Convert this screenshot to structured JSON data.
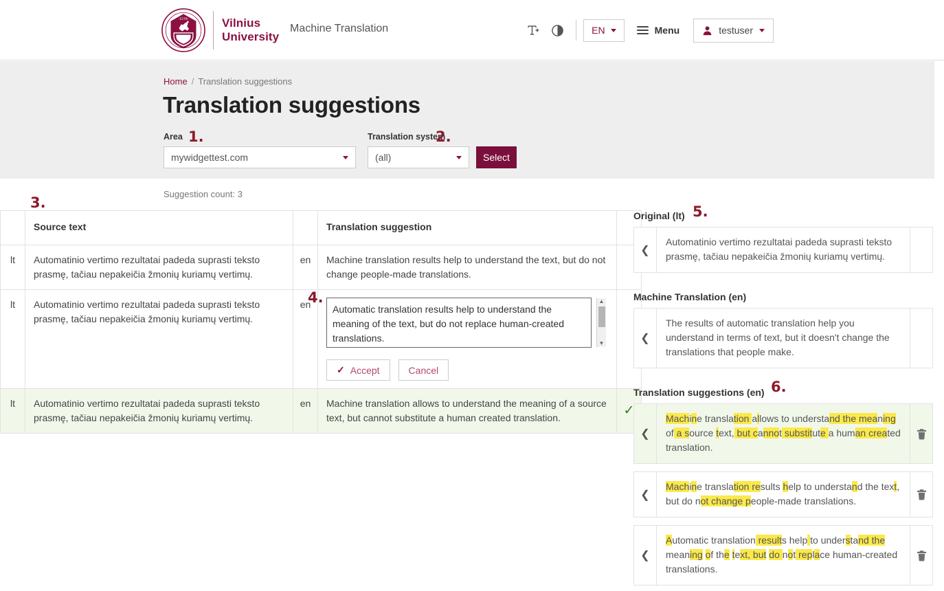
{
  "header": {
    "logo_line1": "Vilnius",
    "logo_line2": "University",
    "crest_year": "1579",
    "crest_top_text": "VILNIAUS UNIVERSITETAS",
    "crest_bottom_text": "UNIVERSITAS VILNENSIS",
    "app_title": "Machine Translation",
    "font_size_icon": "font-size-icon",
    "contrast_icon": "contrast-icon",
    "language": "EN",
    "menu_label": "Menu",
    "user_label": "testuser"
  },
  "breadcrumb": {
    "home": "Home",
    "separator": "/",
    "current": "Translation suggestions"
  },
  "page_title": "Translation suggestions",
  "filters": {
    "area_label": "Area",
    "area_value": "mywidgettest.com",
    "system_label": "Translation system",
    "system_value": "(all)",
    "select_button": "Select"
  },
  "annotations": {
    "a1": "1.",
    "a2": "2.",
    "a3": "3.",
    "a4": "4.",
    "a5": "5.",
    "a6": "6."
  },
  "suggestion_count": "Suggestion count: 3",
  "table": {
    "headers": {
      "lang": "",
      "source": "Source text",
      "target_lang": "",
      "suggestion": "Translation suggestion",
      "actions": ""
    },
    "rows": [
      {
        "src_lang": "lt",
        "source": "Automatinio vertimo rezultatai padeda suprasti teksto prasmę, tačiau nepakeičia žmonių kuriamų vertimų.",
        "tgt_lang": "en",
        "suggestion": "Machine translation results help to understand the text, but do not change people-made translations.",
        "action": ""
      },
      {
        "src_lang": "lt",
        "source": "Automatinio vertimo rezultatai padeda suprasti teksto prasmę, tačiau nepakeičia žmonių kuriamų vertimų.",
        "tgt_lang": "en",
        "editor_value": "Automatic translation results help to understand the meaning of the text, but do not replace human-created translations.",
        "accept_label": "Accept",
        "cancel_label": "Cancel",
        "action": ""
      },
      {
        "src_lang": "lt",
        "source": "Automatinio vertimo rezultatai padeda suprasti teksto prasmę, tačiau nepakeičia žmonių kuriamų vertimų.",
        "tgt_lang": "en",
        "suggestion": "Machine translation allows to understand the meaning of a source text, but cannot substitute a human created translation.",
        "action": "accepted-check"
      }
    ]
  },
  "panel": {
    "original_label": "Original (lt)",
    "original_text": "Automatinio vertimo rezultatai padeda suprasti teksto prasmę, tačiau nepakeičia žmonių kuriamų vertimų.",
    "machine_label": "Machine Translation (en)",
    "machine_text": "The results of automatic translation help you understand in terms of text, but it doesn't change the translations that people make.",
    "suggestions_label": "Translation suggestions (en)",
    "suggestions": [
      {
        "plain": "Machine translation allows to understand the meaning of a source text, but cannot substitute a human created translation.",
        "segments": [
          {
            "t": "Mach",
            "h": true
          },
          {
            "t": "i",
            "h": false
          },
          {
            "t": "n",
            "h": true
          },
          {
            "t": "e translation ",
            "h": false
          },
          {
            "t": "a",
            "h": true
          },
          {
            "t": "l",
            "h": false
          },
          {
            "t": "lows ",
            "h": true
          },
          {
            "t": "t",
            "h": true
          },
          {
            "t": "o understand ",
            "h": false
          },
          {
            "t": "the meanin",
            "h": true
          },
          {
            "t": "g",
            "h": true
          },
          {
            "t": " ",
            "h": false
          },
          {
            "t": "of a ",
            "h": true
          },
          {
            "t": "so",
            "h": false
          },
          {
            "t": "urce",
            "h": true
          },
          {
            "t": " text,",
            "h": false
          },
          {
            "t": "|",
            "h": true
          },
          {
            "t": "but ",
            "h": false
          },
          {
            "t": "cannot",
            "h": true
          },
          {
            "t": " ",
            "h": false
          },
          {
            "t": "sub",
            "h": true
          },
          {
            "t": "s",
            "h": false
          },
          {
            "t": "titute a",
            "h": true
          },
          {
            "t": " h",
            "h": false
          },
          {
            "t": "um",
            "h": true
          },
          {
            "t": "an ",
            "h": false
          },
          {
            "t": "create",
            "h": true
          },
          {
            "t": "d",
            "h": true
          },
          {
            "t": " translation.",
            "h": false
          }
        ],
        "highlighted": true,
        "delete_icon": "trash-icon"
      },
      {
        "plain": "Machine translation results help to understand the text, but do not change people-made translations.",
        "delete_icon": "trash-icon"
      },
      {
        "plain": "Automatic translation results help to understand the meaning of the text, but do not replace human-created translations.",
        "delete_icon": "trash-icon"
      }
    ]
  },
  "colors": {
    "brand": "#8c1042",
    "brand_dark": "#7b0f3b",
    "band": "#eeeeee",
    "highlight": "#fbe94a",
    "accepted_row": "#f1f8ea",
    "check_green": "#2e7d1e",
    "annotation": "#8c1b2b"
  }
}
